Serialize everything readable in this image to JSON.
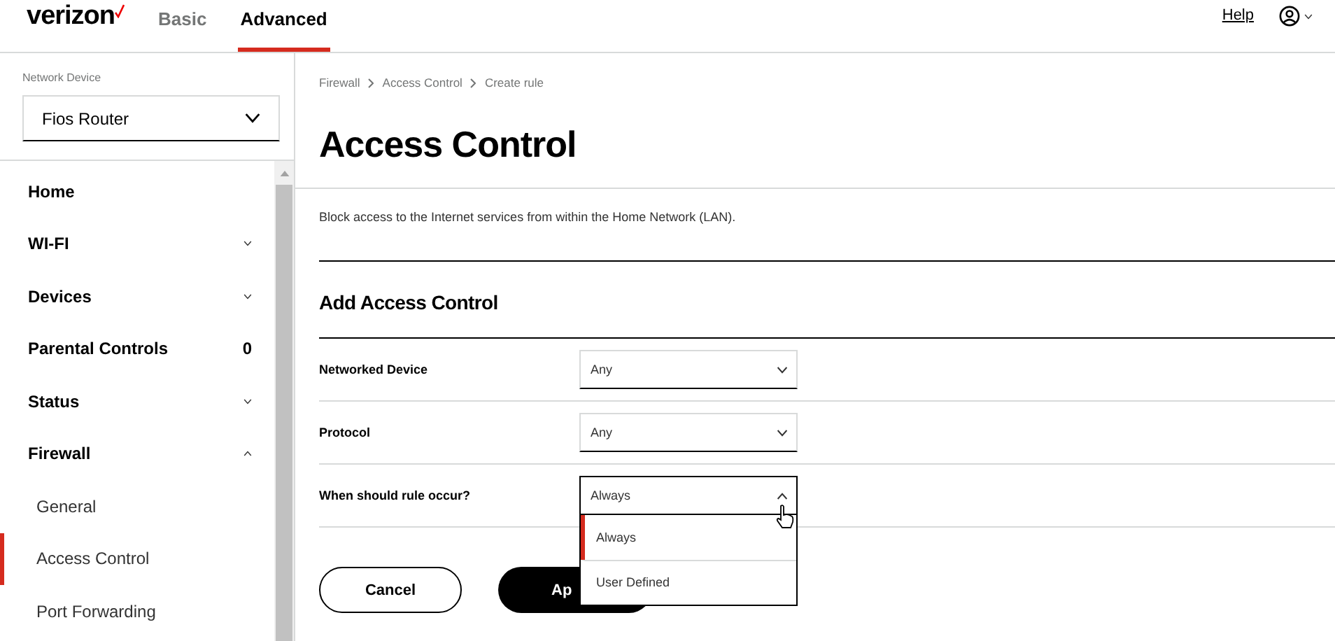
{
  "header": {
    "logo": "verizon",
    "tabs": [
      {
        "label": "Basic",
        "selected": false
      },
      {
        "label": "Advanced",
        "selected": true
      }
    ],
    "help": "Help"
  },
  "sidebar": {
    "device_label": "Network Device",
    "device_value": "Fios Router",
    "items": [
      {
        "label": "Home",
        "kind": "link"
      },
      {
        "label": "WI-FI",
        "kind": "section",
        "expanded": false
      },
      {
        "label": "Devices",
        "kind": "section",
        "expanded": false
      },
      {
        "label": "Parental Controls",
        "kind": "badge",
        "badge": "0"
      },
      {
        "label": "Status",
        "kind": "section",
        "expanded": false
      },
      {
        "label": "Firewall",
        "kind": "section",
        "expanded": true,
        "children": [
          {
            "label": "General",
            "selected": false
          },
          {
            "label": "Access Control",
            "selected": true
          },
          {
            "label": "Port Forwarding",
            "selected": false
          }
        ]
      }
    ]
  },
  "breadcrumb": [
    "Firewall",
    "Access Control",
    "Create rule"
  ],
  "title": "Access Control",
  "description": "Block access to the Internet services from within the Home Network (LAN).",
  "section_title": "Add Access Control",
  "fields": [
    {
      "label": "Networked Device",
      "value": "Any",
      "expanded": false
    },
    {
      "label": "Protocol",
      "value": "Any",
      "expanded": false
    },
    {
      "label": "When should rule occur?",
      "value": "Always",
      "expanded": true,
      "options": [
        {
          "label": "Always",
          "selected": true
        },
        {
          "label": "User Defined",
          "selected": false
        }
      ]
    }
  ],
  "buttons": {
    "cancel": "Cancel",
    "apply": "Ap"
  }
}
